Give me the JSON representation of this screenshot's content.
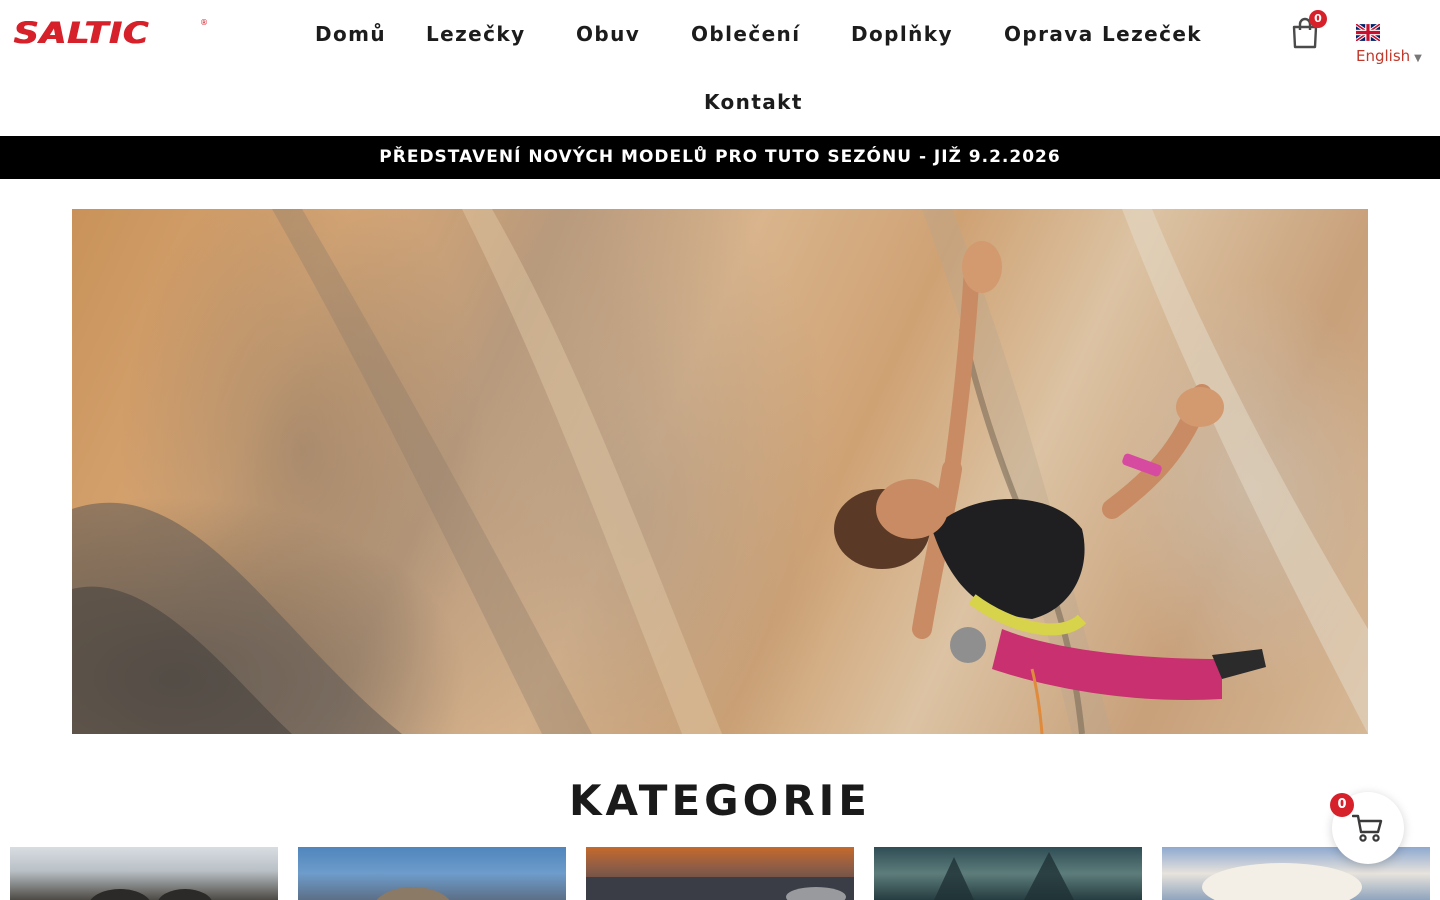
{
  "brand": {
    "logo_text": "SALTIC",
    "registered_mark": "®",
    "accent_color": "#d6212b"
  },
  "nav": {
    "items": [
      {
        "label": "Domů"
      },
      {
        "label": "Lezečky"
      },
      {
        "label": "Obuv"
      },
      {
        "label": "Oblečení"
      },
      {
        "label": "Doplňky"
      },
      {
        "label": "Oprava Lezeček"
      },
      {
        "label": "Kontakt"
      }
    ]
  },
  "cart": {
    "count": "0",
    "icon": "shopping-bag-icon"
  },
  "language": {
    "selected": "English",
    "flag": "uk-flag-icon"
  },
  "announcement": {
    "text": "PŘEDSTAVENÍ NOVÝCH MODELŮ PRO TUTO SEZÓNU - JIŽ 9.2.2026",
    "background": "#000000"
  },
  "hero": {
    "image": "climber-on-rock-wall"
  },
  "categories": {
    "title": "KATEGORIE",
    "cards": [
      {
        "image": "category-image-1"
      },
      {
        "image": "category-image-2"
      },
      {
        "image": "category-image-3"
      },
      {
        "image": "category-image-4"
      },
      {
        "image": "category-image-5"
      }
    ]
  },
  "floating_cart": {
    "count": "0",
    "icon": "shopping-cart-icon"
  }
}
